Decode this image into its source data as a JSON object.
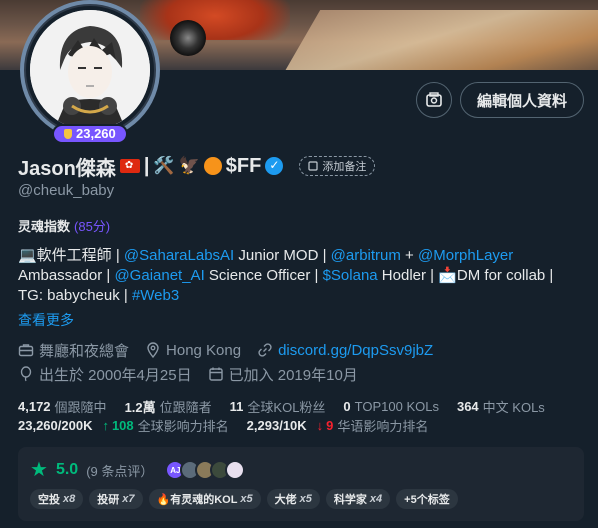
{
  "profile": {
    "name": "Jason傑森",
    "name_suffix": "|",
    "emoji_tools": "🛠️",
    "emoji_eagle": "🦅",
    "ticker": "$FF",
    "handle": "@cheuk_baby",
    "score_badge": "23,260",
    "note_button": "添加备注",
    "edit_button": "編輯個人資料"
  },
  "soul": {
    "label": "灵魂指数",
    "value": "(85分)"
  },
  "bio": {
    "line1_prefix": "💻軟件工程師 | ",
    "mention1": "@SaharaLabsAI",
    "line1_mid": " Junior MOD | ",
    "mention2": "@arbitrum",
    "line1_plus": " + ",
    "mention3": "@MorphLayer",
    "line2_prefix": "Ambassador | ",
    "mention4": "@Gaianet_AI",
    "line2_mid": " Science Officer | ",
    "mention5": "$Solana",
    "line2_end": " Hodler | 📩DM for collab |",
    "line3_prefix": "TG: babycheuk | ",
    "hashtag": "#Web3",
    "show_more": "查看更多"
  },
  "meta": {
    "category": "舞廳和夜總會",
    "location": "Hong Kong",
    "url": "discord.gg/DqpSsv9jbZ",
    "born": "出生於 2000年4月25日",
    "joined": "已加入 2019年10月"
  },
  "stats": {
    "following_num": "4,172",
    "following_label": "個跟隨中",
    "followers_num": "1.2萬",
    "followers_label": "位跟隨者",
    "kol_fans_num": "11",
    "kol_fans_label": "全球KOL粉丝",
    "top100_num": "0",
    "top100_label": "TOP100 KOLs",
    "cn_kols_num": "364",
    "cn_kols_label": "中文 KOLs",
    "global_rank": "23,260/200K",
    "global_change": "108",
    "global_label": "全球影响力排名",
    "cn_rank": "2,293/10K",
    "cn_change": "9",
    "cn_label": "华语影响力排名"
  },
  "reviews": {
    "rating": "5.0",
    "count": "(9 条点评）",
    "avatar_initials": "AJ"
  },
  "tags": [
    {
      "label": "空投",
      "mult": "x8"
    },
    {
      "label": "投研",
      "mult": "x7"
    },
    {
      "label": "🔥有灵魂的KOL",
      "mult": "x5"
    },
    {
      "label": "大佬",
      "mult": "x5"
    },
    {
      "label": "科学家",
      "mult": "x4"
    },
    {
      "label": "+5个标签",
      "mult": ""
    }
  ],
  "colors": {
    "background": "#15202b",
    "accent_blue": "#1d9bf0",
    "accent_purple": "#7856ff",
    "green": "#00ba7c",
    "red": "#f4212e"
  },
  "icons": [
    "media-icon",
    "briefcase-icon",
    "location-icon",
    "link-icon",
    "balloon-icon",
    "calendar-icon",
    "star-icon",
    "verified-icon"
  ]
}
